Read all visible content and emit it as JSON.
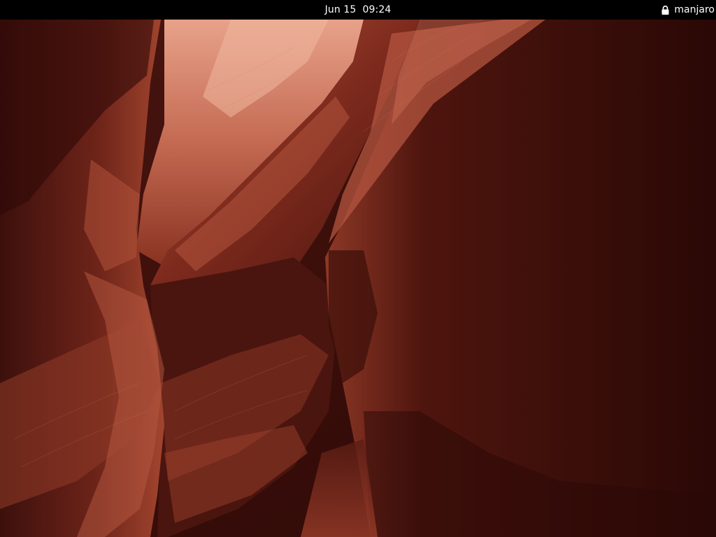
{
  "top_bar": {
    "date": "Jun 15",
    "time": "09:24",
    "username": "manjaro",
    "lock_icon": "lock-icon"
  },
  "wallpaper": {
    "subject": "slot canyon sandstone walls",
    "colors": {
      "deep_shadow": "#1e0605",
      "dark": "#3d0f0b",
      "mid": "#7a2a1f",
      "light": "#b5553f",
      "highlight": "#e09479"
    }
  }
}
